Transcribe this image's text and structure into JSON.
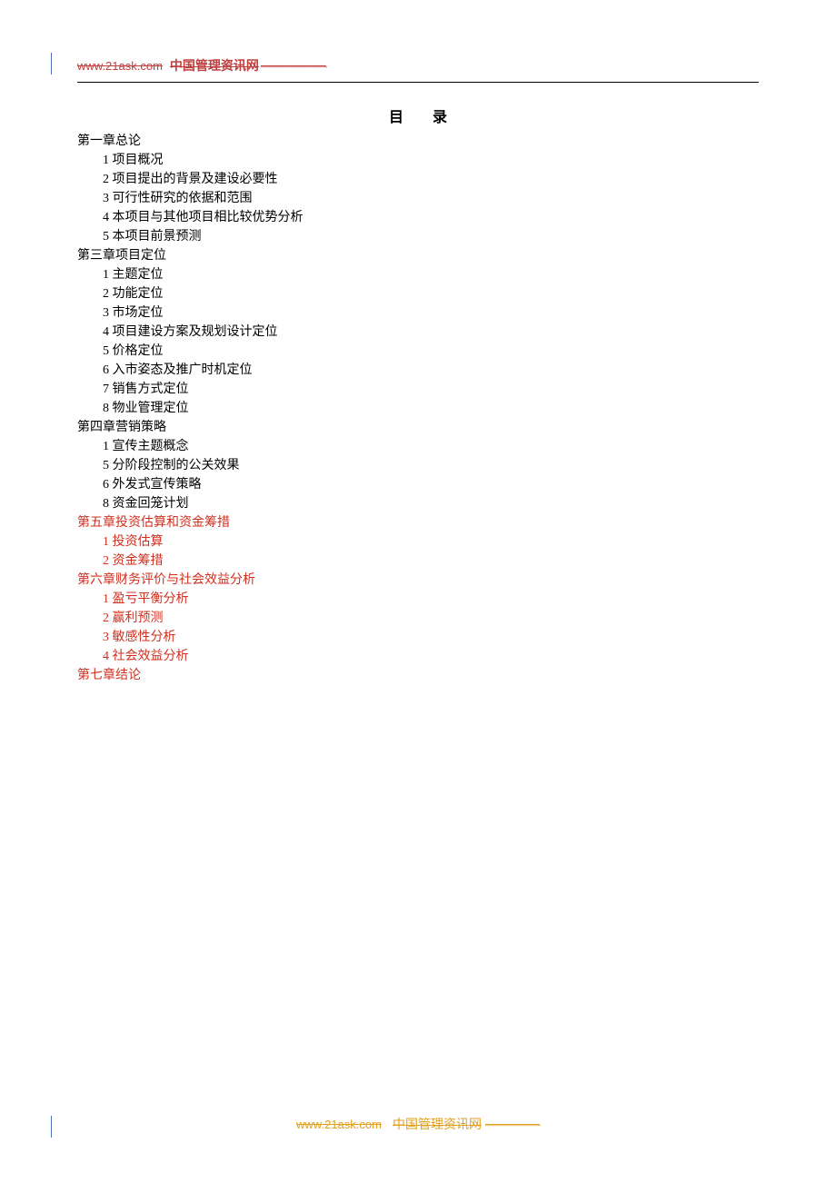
{
  "header": {
    "url": "www.21ask.com",
    "text": "中国管理资讯网"
  },
  "title": "目　　录",
  "toc": [
    {
      "type": "chap",
      "red": false,
      "text": "第一章总论"
    },
    {
      "type": "sub",
      "red": false,
      "text": "1 项目概况"
    },
    {
      "type": "sub",
      "red": false,
      "text": "2 项目提出的背景及建设必要性"
    },
    {
      "type": "sub",
      "red": false,
      "text": "3 可行性研究的依据和范围"
    },
    {
      "type": "sub",
      "red": false,
      "text": "4 本项目与其他项目相比较优势分析"
    },
    {
      "type": "sub",
      "red": false,
      "text": "5 本项目前景预测"
    },
    {
      "type": "chap",
      "red": false,
      "text": "第三章项目定位"
    },
    {
      "type": "sub",
      "red": false,
      "text": "1 主题定位"
    },
    {
      "type": "sub",
      "red": false,
      "text": "2 功能定位"
    },
    {
      "type": "sub",
      "red": false,
      "text": "3 市场定位"
    },
    {
      "type": "sub",
      "red": false,
      "text": "4 项目建设方案及规划设计定位"
    },
    {
      "type": "sub",
      "red": false,
      "text": "5 价格定位"
    },
    {
      "type": "sub",
      "red": false,
      "text": "6 入市姿态及推广时机定位"
    },
    {
      "type": "sub",
      "red": false,
      "text": "7 销售方式定位"
    },
    {
      "type": "sub",
      "red": false,
      "text": "8 物业管理定位"
    },
    {
      "type": "chap",
      "red": false,
      "text": "第四章营销策略"
    },
    {
      "type": "sub",
      "red": false,
      "text": "1 宣传主题概念"
    },
    {
      "type": "sub",
      "red": false,
      "text": "5 分阶段控制的公关效果"
    },
    {
      "type": "sub",
      "red": false,
      "text": "6 外发式宣传策略"
    },
    {
      "type": "sub",
      "red": false,
      "text": "8 资金回笼计划"
    },
    {
      "type": "chap",
      "red": true,
      "text": "第五章投资估算和资金筹措"
    },
    {
      "type": "sub",
      "red": true,
      "text": "1 投资估算"
    },
    {
      "type": "sub",
      "red": true,
      "text": "2 资金筹措"
    },
    {
      "type": "chap",
      "red": true,
      "text": "第六章财务评价与社会效益分析"
    },
    {
      "type": "sub",
      "red": true,
      "text": "1 盈亏平衡分析"
    },
    {
      "type": "sub",
      "red": true,
      "text": "2 赢利预测"
    },
    {
      "type": "sub",
      "red": true,
      "text": "3 敏感性分析"
    },
    {
      "type": "sub",
      "red": true,
      "text": "4 社会效益分析"
    },
    {
      "type": "chap",
      "red": true,
      "text": "第七章结论"
    }
  ],
  "footer": {
    "url": "www.21ask.com",
    "text": "中国管理资讯网"
  }
}
